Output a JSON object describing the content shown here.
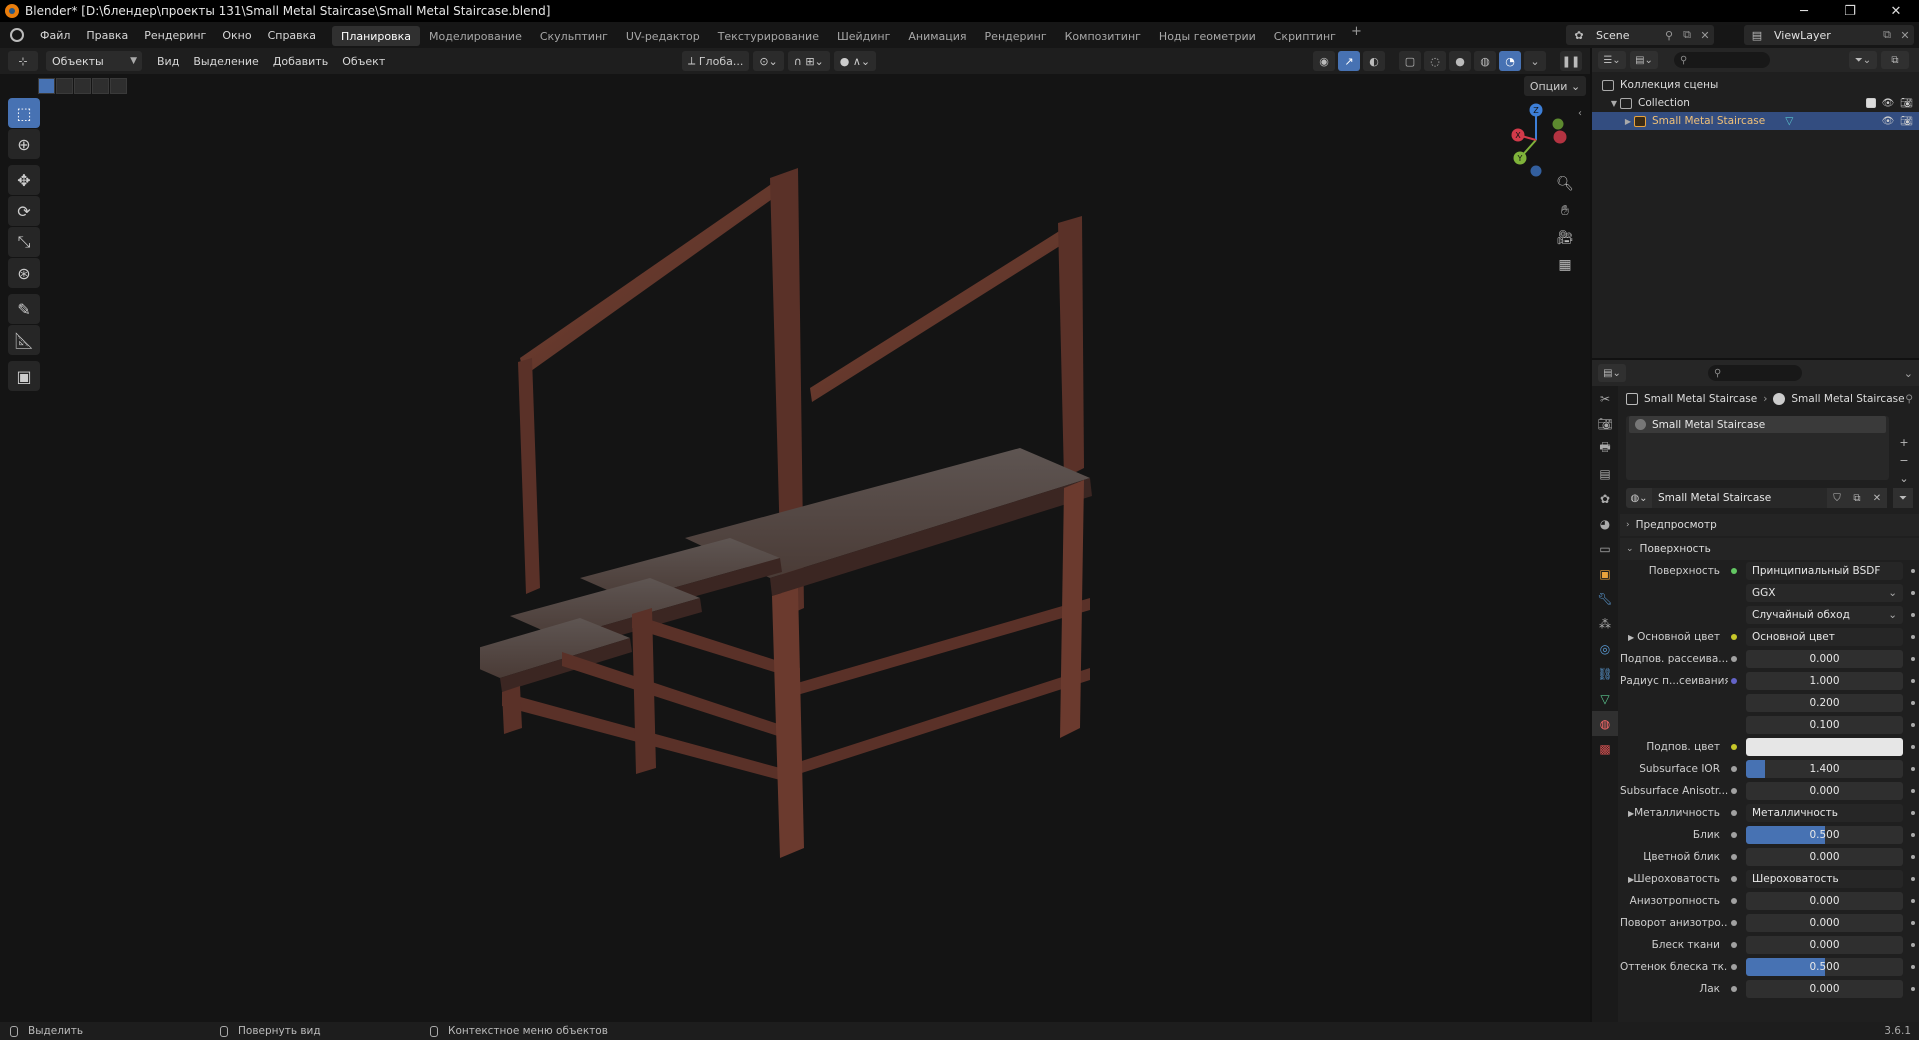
{
  "window": {
    "title": "Blender* [D:\\блендер\\проекты 131\\Small Metal Staircase\\Small Metal Staircase.blend]",
    "controls": [
      "─",
      "❐",
      "✕"
    ]
  },
  "menu": {
    "items": [
      "Файл",
      "Правка",
      "Рендеринг",
      "Окно",
      "Справка"
    ],
    "workspaces": [
      "Планировка",
      "Моделирование",
      "Скульптинг",
      "UV-редактор",
      "Текстурирование",
      "Шейдинг",
      "Анимация",
      "Рендеринг",
      "Композитинг",
      "Ноды геометрии",
      "Скриптинг"
    ],
    "active_workspace": "Планировка",
    "add_tab": "+",
    "scene": "Scene",
    "view_layer": "ViewLayer"
  },
  "viewport": {
    "mode": "Объекты",
    "menus": [
      "Вид",
      "Выделение",
      "Добавить",
      "Объект"
    ],
    "orientation": "Глоба...",
    "options": "Опции",
    "gizmo_labels": {
      "x": "X",
      "y": "Y",
      "z": "Z"
    }
  },
  "outliner": {
    "scene_collection": "Коллекция сцены",
    "collection": "Collection",
    "object": "Small Metal Staircase"
  },
  "properties": {
    "breadcrumb_object": "Small Metal Staircase",
    "breadcrumb_material": "Small Metal Staircase",
    "slot_name": "Small Metal Staircase",
    "material_name": "Small Metal Staircase",
    "panel_preview": "Предпросмотр",
    "panel_surface": "Поверхность",
    "rows": [
      {
        "label": "Поверхность",
        "value": "Принципиальный BSDF",
        "kind": "link",
        "socket": "g"
      },
      {
        "label": "",
        "value": "GGX",
        "kind": "drop"
      },
      {
        "label": "",
        "value": "Случайный обход",
        "kind": "drop"
      },
      {
        "label": "Основной цвет",
        "value": "Основной цвет",
        "kind": "link",
        "socket": "y",
        "tri": true
      },
      {
        "label": "Подпов. рассеива...",
        "value": "0.000",
        "kind": "num",
        "socket": "gray",
        "fill": 0
      },
      {
        "label": "Радиус п...сеивания",
        "value": "1.000",
        "kind": "num",
        "socket": "p",
        "fill": 0
      },
      {
        "label": "",
        "value": "0.200",
        "kind": "num",
        "fill": 0
      },
      {
        "label": "",
        "value": "0.100",
        "kind": "num",
        "fill": 0
      },
      {
        "label": "Подпов. цвет",
        "value": "",
        "kind": "color",
        "socket": "y"
      },
      {
        "label": "Subsurface IOR",
        "value": "1.400",
        "kind": "num",
        "socket": "gray",
        "fill": 0.12
      },
      {
        "label": "Subsurface Anisotr...",
        "value": "0.000",
        "kind": "num",
        "socket": "gray",
        "fill": 0
      },
      {
        "label": "Металличность",
        "value": "Металличность",
        "kind": "link",
        "socket": "gray",
        "tri": true
      },
      {
        "label": "Блик",
        "value": "0.500",
        "kind": "num",
        "socket": "gray",
        "fill": 0.5
      },
      {
        "label": "Цветной блик",
        "value": "0.000",
        "kind": "num",
        "socket": "gray",
        "fill": 0
      },
      {
        "label": "Шероховатость",
        "value": "Шероховатость",
        "kind": "link",
        "socket": "gray",
        "tri": true
      },
      {
        "label": "Анизотропность",
        "value": "0.000",
        "kind": "num",
        "socket": "gray",
        "fill": 0
      },
      {
        "label": "Поворот анизотро...",
        "value": "0.000",
        "kind": "num",
        "socket": "gray",
        "fill": 0
      },
      {
        "label": "Блеск ткани",
        "value": "0.000",
        "kind": "num",
        "socket": "gray",
        "fill": 0
      },
      {
        "label": "Оттенок блеска тк...",
        "value": "0.500",
        "kind": "num",
        "socket": "gray",
        "fill": 0.5
      },
      {
        "label": "Лак",
        "value": "0.000",
        "kind": "num",
        "socket": "gray",
        "fill": 0
      }
    ]
  },
  "status": {
    "select": "Выделить",
    "rotate": "Повернуть вид",
    "context": "Контекстное меню объектов",
    "version": "3.6.1"
  },
  "colors": {
    "accent": "#4772b3",
    "selected_row": "#334d80",
    "rust": "#6b3a2e"
  }
}
